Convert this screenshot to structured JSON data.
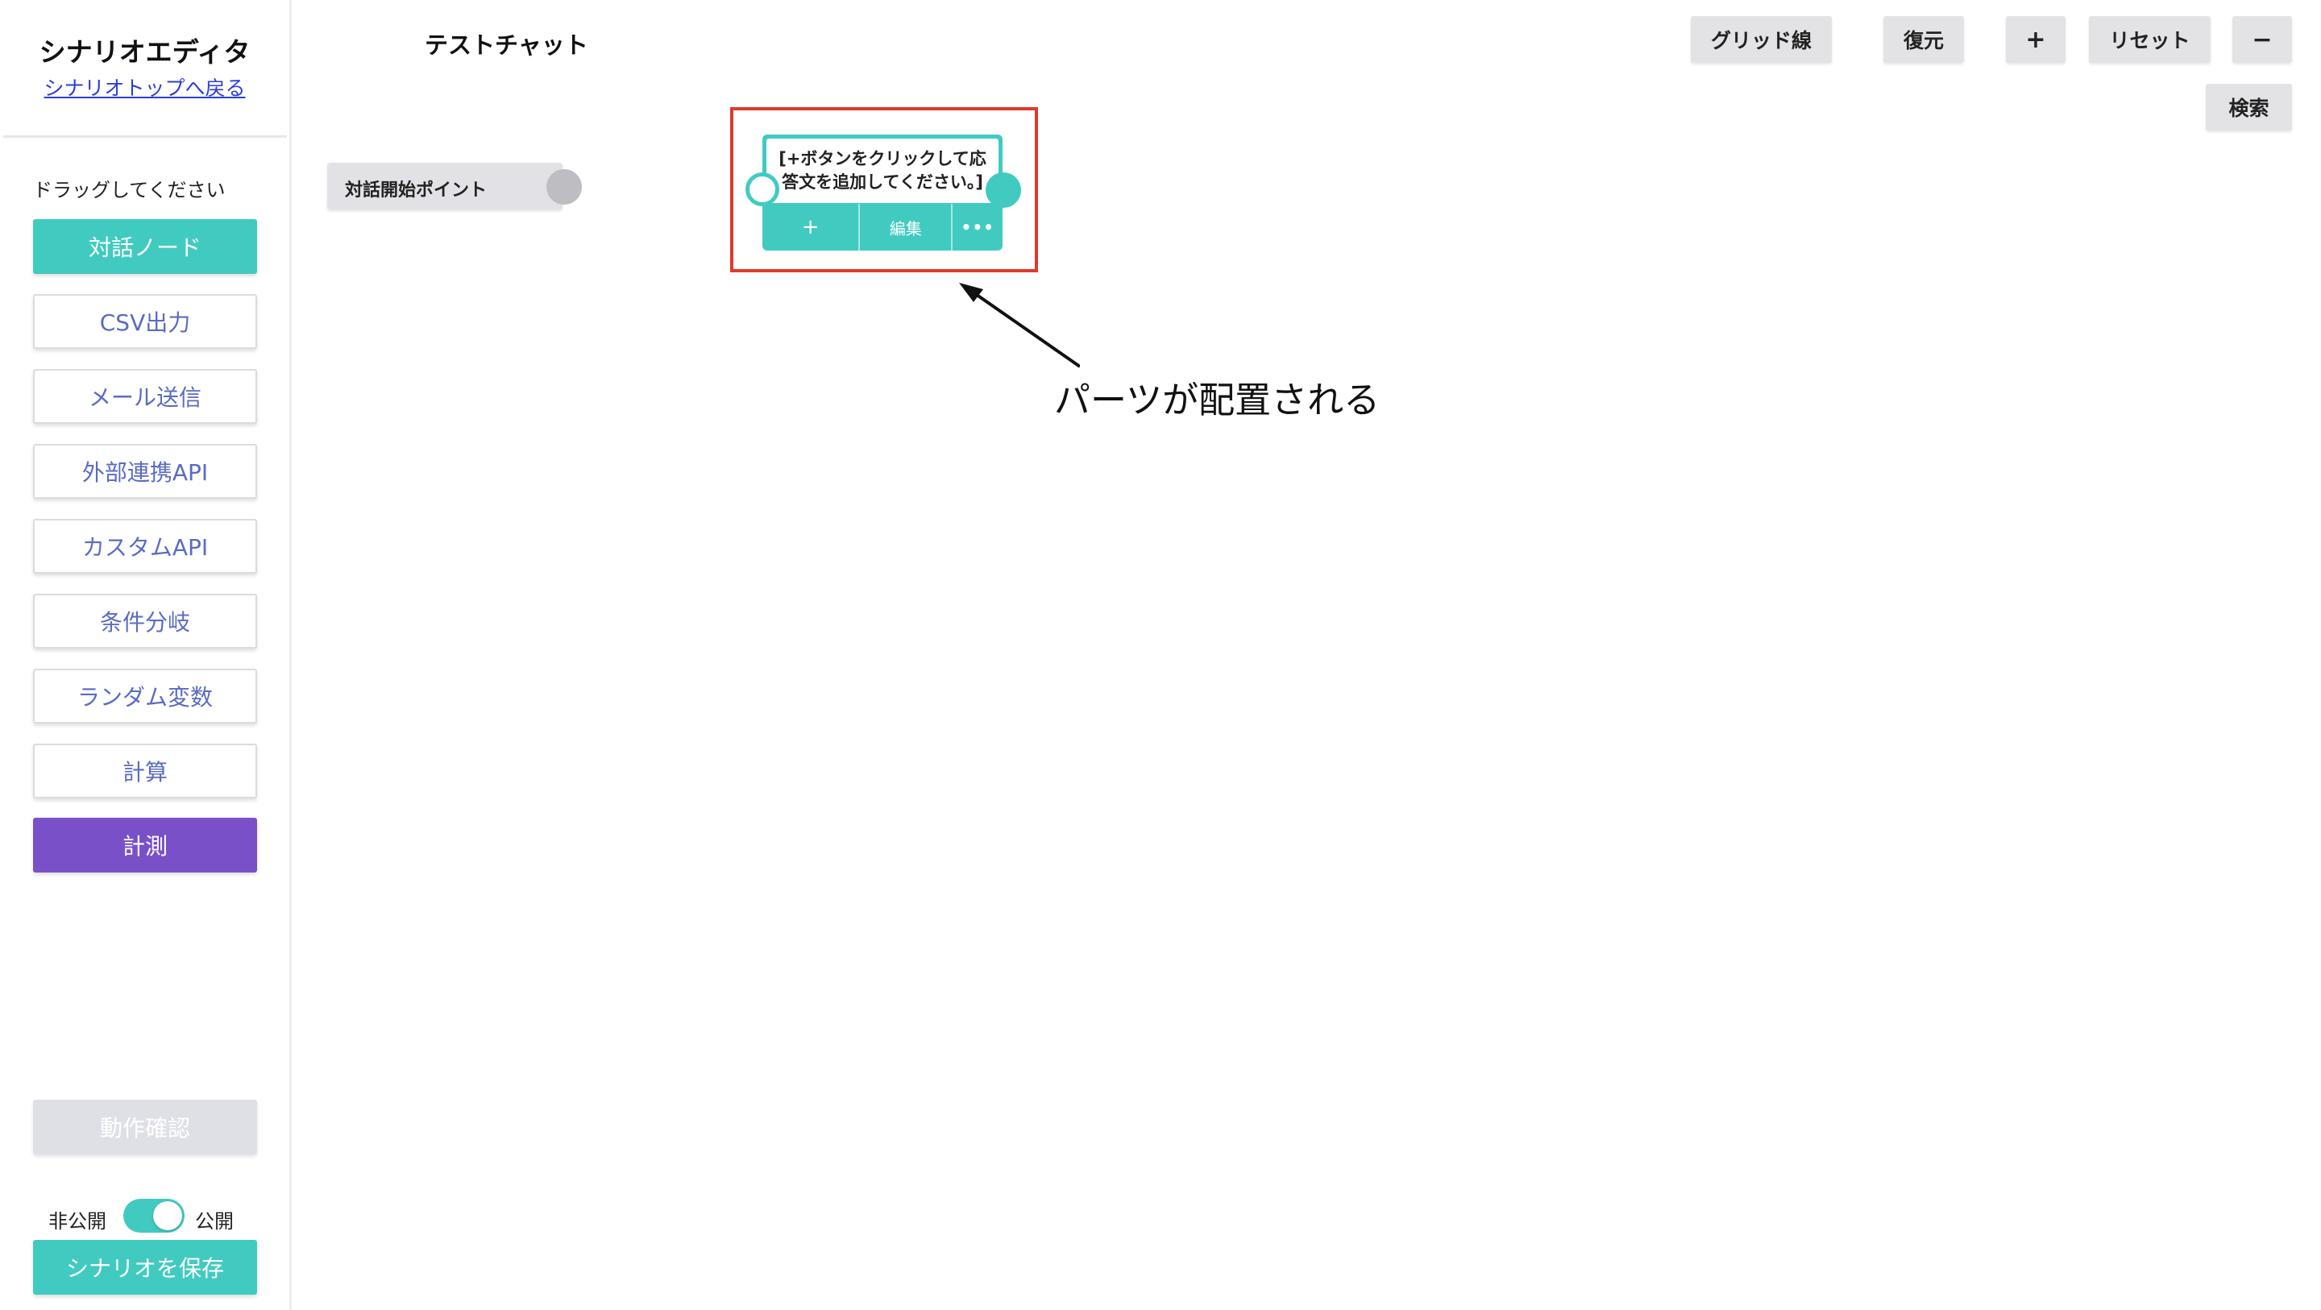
{
  "sidebar": {
    "title": "シナリオエディタ",
    "back_link": "シナリオトップへ戻る",
    "drag_hint": "ドラッグしてください",
    "palette": [
      {
        "label": "対話ノード",
        "style": "teal"
      },
      {
        "label": "CSV出力",
        "style": "outline"
      },
      {
        "label": "メール送信",
        "style": "outline"
      },
      {
        "label": "外部連携API",
        "style": "outline"
      },
      {
        "label": "カスタムAPI",
        "style": "outline"
      },
      {
        "label": "条件分岐",
        "style": "outline"
      },
      {
        "label": "ランダム変数",
        "style": "outline"
      },
      {
        "label": "計算",
        "style": "outline"
      },
      {
        "label": "計測",
        "style": "purple"
      }
    ],
    "verify_button": "動作確認",
    "publish": {
      "off_label": "非公開",
      "on_label": "公開",
      "state": "公開"
    },
    "save_button": "シナリオを保存"
  },
  "header": {
    "test_chat": "テストチャット",
    "toolbar": {
      "grid": "グリッド線",
      "restore": "復元",
      "zoom_in": "+",
      "reset": "リセット",
      "zoom_out": "−",
      "search": "検索"
    }
  },
  "canvas": {
    "start_node": {
      "label": "対話開始ポイント"
    },
    "dialog_node": {
      "text": "[+ボタンをクリックして応答文を追加してください。]",
      "add": "+",
      "edit": "編集",
      "more": "•••"
    },
    "annotation": "パーツが配置される"
  },
  "colors": {
    "teal": "#41cbc0",
    "purple": "#7a50c9",
    "highlight": "#e03a2a",
    "link": "#2c3ed6"
  }
}
